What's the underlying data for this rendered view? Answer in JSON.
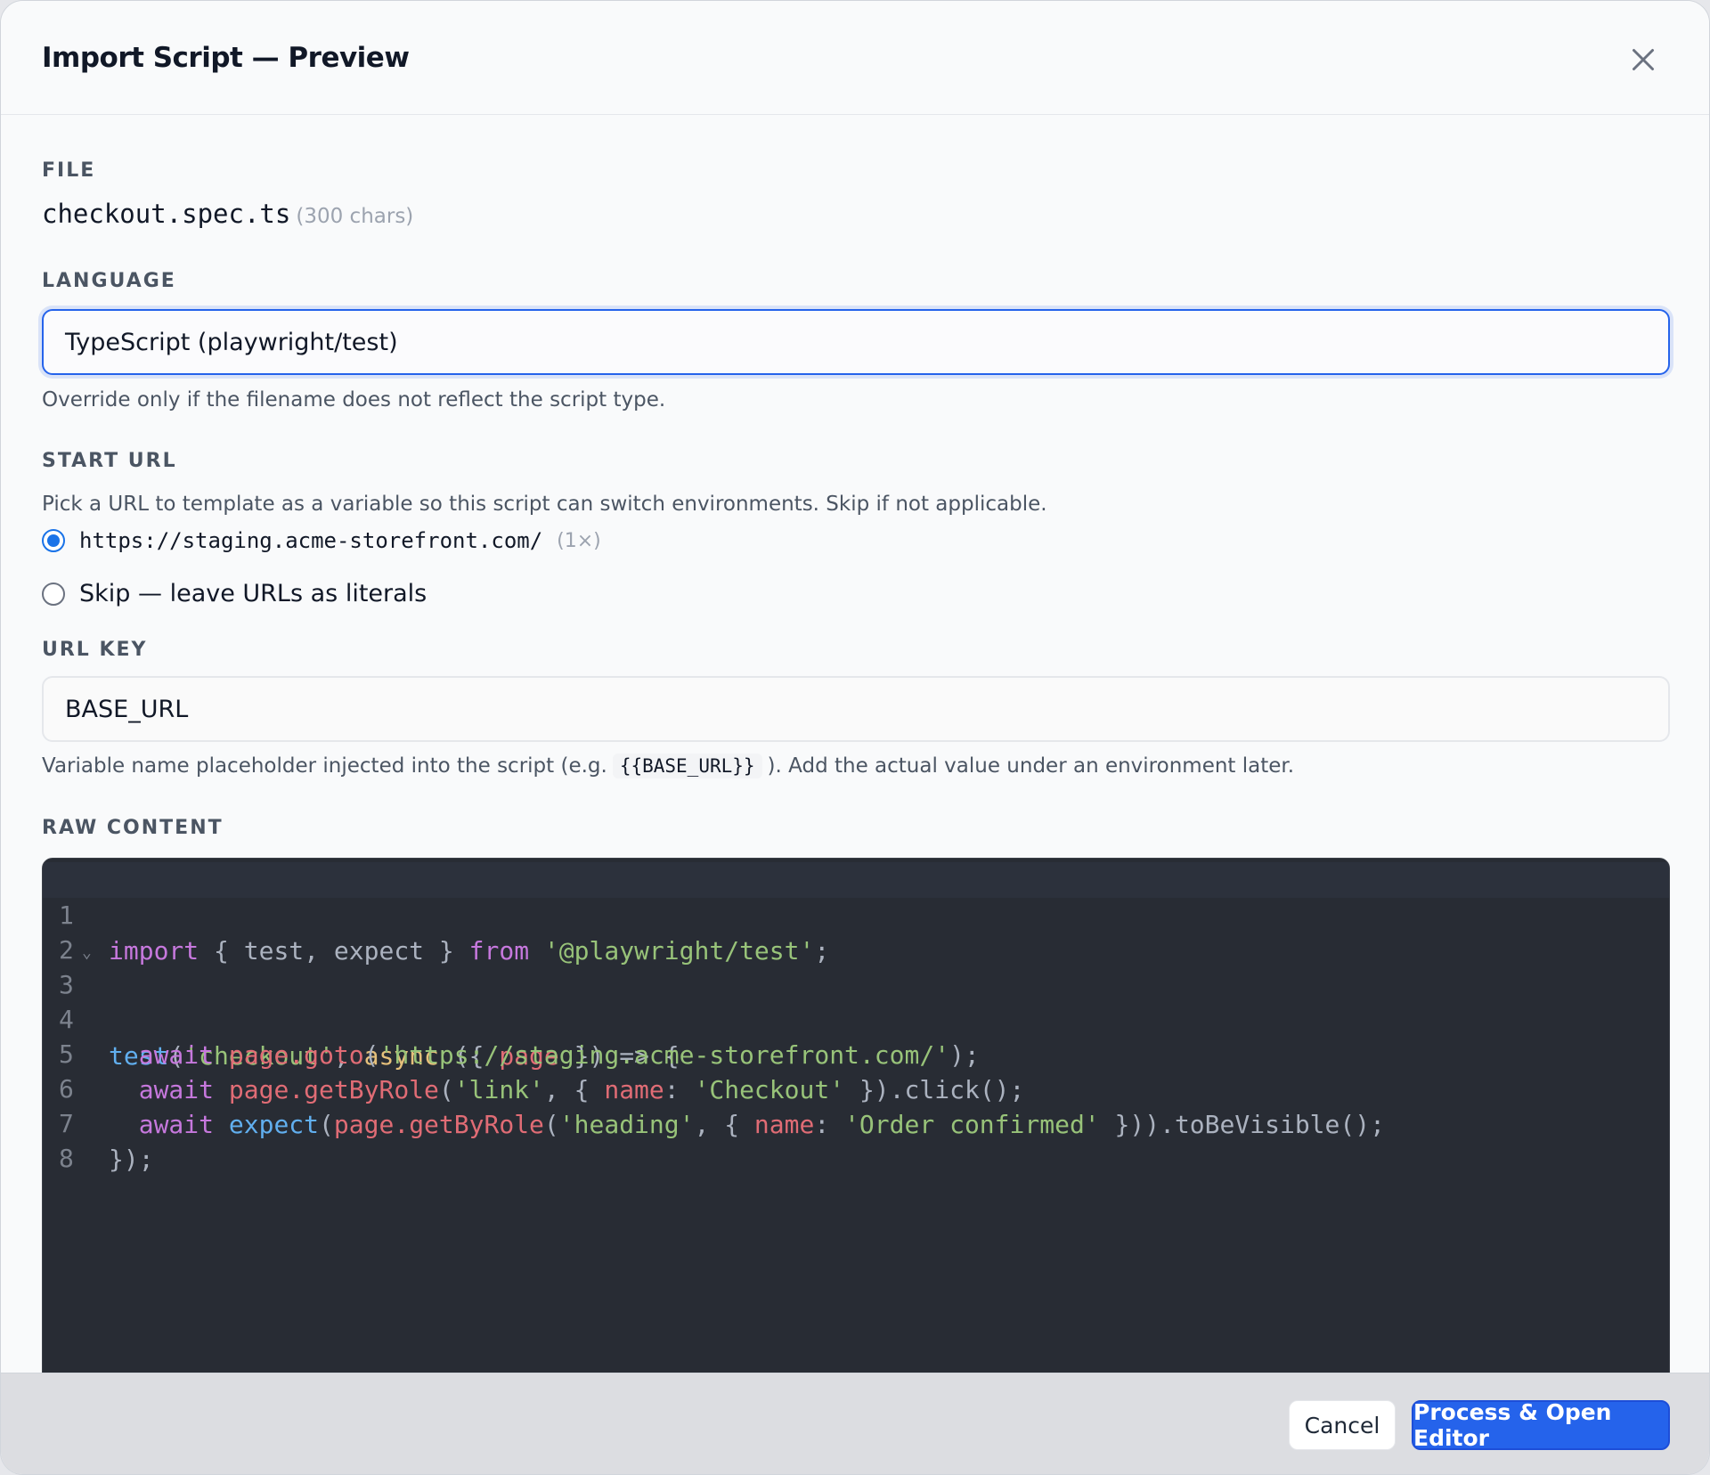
{
  "dialog": {
    "title": "Import Script — Preview"
  },
  "file": {
    "label": "FILE",
    "name": "checkout.spec.ts",
    "chars": "(300 chars)"
  },
  "language": {
    "label": "LANGUAGE",
    "value": "TypeScript (playwright/test)",
    "hint": "Override only if the filename does not reflect the script type."
  },
  "start_url": {
    "label": "START URL",
    "hint": "Pick a URL to template as a variable so this script can switch environments. Skip if not applicable.",
    "options": [
      {
        "url": "https://staging.acme-storefront.com/",
        "count": "(1×)",
        "checked": true
      },
      {
        "label": "Skip — leave URLs as literals",
        "checked": false
      }
    ]
  },
  "url_key": {
    "label": "URL KEY",
    "value": "BASE_URL",
    "hint_before": "Variable name placeholder injected into the script (e.g.",
    "hint_code": "{{BASE_URL}}",
    "hint_after": "). Add the actual value under an environment later."
  },
  "raw_content": {
    "label": "RAW CONTENT",
    "line_numbers": [
      "1",
      "2",
      "3",
      "4",
      "5",
      "6",
      "7",
      "8"
    ],
    "lines": [
      "import { test, expect } from '@playwright/test';",
      "",
      "test('checkout', async ({ page }) => {",
      "  await page.goto('https://staging.acme-storefront.com/');",
      "  await page.getByRole('link', { name: 'Checkout' }).click();",
      "  await expect(page.getByRole('heading', { name: 'Order confirmed' })).toBeVisible();",
      "});",
      ""
    ]
  },
  "footer": {
    "cancel_label": "Cancel",
    "primary_label": "Process & Open Editor"
  },
  "colors": {
    "accent": "#2563eb",
    "editor_bg": "#282c34"
  }
}
